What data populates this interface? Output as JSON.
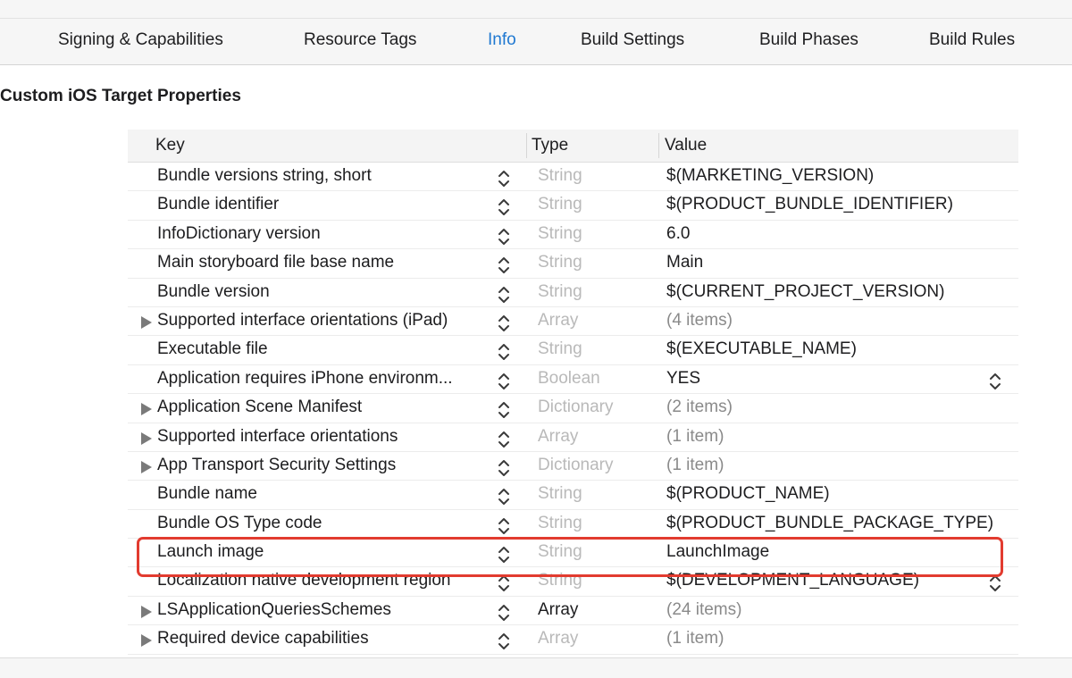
{
  "tabs": [
    {
      "label": "Signing & Capabilities",
      "active": false
    },
    {
      "label": "Resource Tags",
      "active": false
    },
    {
      "label": "Info",
      "active": true
    },
    {
      "label": "Build Settings",
      "active": false
    },
    {
      "label": "Build Phases",
      "active": false
    },
    {
      "label": "Build Rules",
      "active": false
    }
  ],
  "section_title": "Custom iOS Target Properties",
  "table": {
    "headers": {
      "key": "Key",
      "type": "Type",
      "value": "Value"
    },
    "rows": [
      {
        "key": "Bundle versions string, short",
        "type": "String",
        "value": "$(MARKETING_VERSION)",
        "expandable": false,
        "value_muted": false,
        "type_dark": false,
        "value_stepper": false
      },
      {
        "key": "Bundle identifier",
        "type": "String",
        "value": "$(PRODUCT_BUNDLE_IDENTIFIER)",
        "expandable": false,
        "value_muted": false,
        "type_dark": false,
        "value_stepper": false
      },
      {
        "key": "InfoDictionary version",
        "type": "String",
        "value": "6.0",
        "expandable": false,
        "value_muted": false,
        "type_dark": false,
        "value_stepper": false
      },
      {
        "key": "Main storyboard file base name",
        "type": "String",
        "value": "Main",
        "expandable": false,
        "value_muted": false,
        "type_dark": false,
        "value_stepper": false
      },
      {
        "key": "Bundle version",
        "type": "String",
        "value": "$(CURRENT_PROJECT_VERSION)",
        "expandable": false,
        "value_muted": false,
        "type_dark": false,
        "value_stepper": false
      },
      {
        "key": "Supported interface orientations (iPad)",
        "type": "Array",
        "value": "(4 items)",
        "expandable": true,
        "value_muted": true,
        "type_dark": false,
        "value_stepper": false
      },
      {
        "key": "Executable file",
        "type": "String",
        "value": "$(EXECUTABLE_NAME)",
        "expandable": false,
        "value_muted": false,
        "type_dark": false,
        "value_stepper": false
      },
      {
        "key": "Application requires iPhone environm...",
        "type": "Boolean",
        "value": "YES",
        "expandable": false,
        "value_muted": false,
        "type_dark": false,
        "value_stepper": true
      },
      {
        "key": "Application Scene Manifest",
        "type": "Dictionary",
        "value": "(2 items)",
        "expandable": true,
        "value_muted": true,
        "type_dark": false,
        "value_stepper": false
      },
      {
        "key": "Supported interface orientations",
        "type": "Array",
        "value": "(1 item)",
        "expandable": true,
        "value_muted": true,
        "type_dark": false,
        "value_stepper": false
      },
      {
        "key": "App Transport Security Settings",
        "type": "Dictionary",
        "value": "(1 item)",
        "expandable": true,
        "value_muted": true,
        "type_dark": false,
        "value_stepper": false
      },
      {
        "key": "Bundle name",
        "type": "String",
        "value": "$(PRODUCT_NAME)",
        "expandable": false,
        "value_muted": false,
        "type_dark": false,
        "value_stepper": false
      },
      {
        "key": "Bundle OS Type code",
        "type": "String",
        "value": "$(PRODUCT_BUNDLE_PACKAGE_TYPE)",
        "expandable": false,
        "value_muted": false,
        "type_dark": false,
        "value_stepper": false
      },
      {
        "key": "Launch image",
        "type": "String",
        "value": "LaunchImage",
        "expandable": false,
        "value_muted": false,
        "type_dark": false,
        "value_stepper": false,
        "highlighted": true
      },
      {
        "key": "Localization native development region",
        "type": "String",
        "value": "$(DEVELOPMENT_LANGUAGE)",
        "expandable": false,
        "value_muted": false,
        "type_dark": false,
        "value_stepper": true
      },
      {
        "key": "LSApplicationQueriesSchemes",
        "type": "Array",
        "value": "(24 items)",
        "expandable": true,
        "value_muted": true,
        "type_dark": true,
        "value_stepper": false
      },
      {
        "key": "Required device capabilities",
        "type": "Array",
        "value": "(1 item)",
        "expandable": true,
        "value_muted": true,
        "type_dark": false,
        "value_stepper": false
      }
    ]
  },
  "colors": {
    "accent": "#1f78d1",
    "highlight_border": "#e23b2f",
    "muted_type": "#b9b9b9",
    "muted_value": "#8a8a8a"
  },
  "icons": {
    "disclosure": "disclosure-triangle-icon",
    "stepper": "up-down-stepper-icon"
  }
}
